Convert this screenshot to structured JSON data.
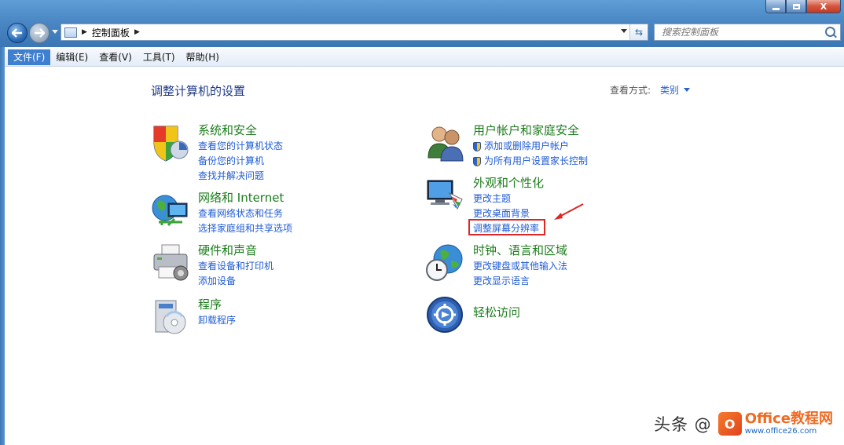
{
  "window": {
    "caption_close": "X",
    "address": {
      "path": "控制面板"
    },
    "search": {
      "placeholder": "搜索控制面板"
    }
  },
  "menu": [
    {
      "label": "文件(F)"
    },
    {
      "label": "编辑(E)"
    },
    {
      "label": "查看(V)"
    },
    {
      "label": "工具(T)"
    },
    {
      "label": "帮助(H)"
    }
  ],
  "main": {
    "title": "调整计算机的设置",
    "view_label": "查看方式:",
    "view_value": "类别"
  },
  "categories": {
    "system": {
      "title": "系统和安全",
      "icon": "shield-icon",
      "links": [
        "查看您的计算机状态",
        "备份您的计算机",
        "查找并解决问题"
      ]
    },
    "network": {
      "title": "网络和 Internet",
      "icon": "globe-network-icon",
      "links": [
        "查看网络状态和任务",
        "选择家庭组和共享选项"
      ]
    },
    "hardware": {
      "title": "硬件和声音",
      "icon": "printer-icon",
      "links": [
        "查看设备和打印机",
        "添加设备"
      ]
    },
    "programs": {
      "title": "程序",
      "icon": "programs-icon",
      "links": [
        "卸载程序"
      ]
    },
    "users": {
      "title": "用户帐户和家庭安全",
      "icon": "users-icon",
      "links": [
        "添加或删除用户帐户",
        "为所有用户设置家长控制"
      ]
    },
    "appearance": {
      "title": "外观和个性化",
      "icon": "monitor-palette-icon",
      "links": [
        "更改主题",
        "更改桌面背景",
        "调整屏幕分辨率"
      ]
    },
    "clock": {
      "title": "时钟、语言和区域",
      "icon": "globe-clock-icon",
      "links": [
        "更改键盘或其他输入法",
        "更改显示语言"
      ]
    },
    "ease": {
      "title": "轻松访问",
      "icon": "accessibility-icon",
      "links": []
    }
  },
  "annotation": {
    "highlight_color": "#e02525"
  },
  "watermark": {
    "text": "头条 @",
    "brand_main": "Office教程网",
    "brand_sub": "www.office26.com"
  }
}
